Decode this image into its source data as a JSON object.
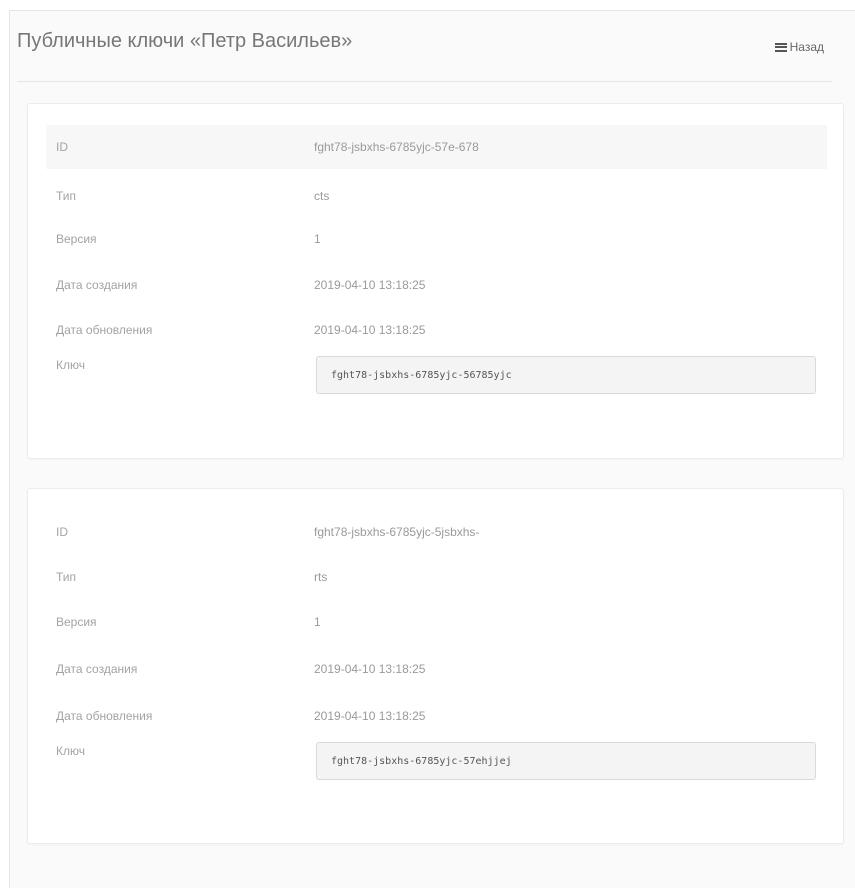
{
  "page": {
    "title": "Публичные ключи «Петр Васильев»",
    "back_label": "Назад"
  },
  "keys": [
    {
      "id_label": "ID",
      "id": "fght78-jsbxhs-6785yjc-57e-678",
      "type_label": "Тип",
      "type": "cts",
      "version_label": "Версия",
      "version": "1",
      "created_label": "Дата создания",
      "created": "2019-04-10 13:18:25",
      "updated_label": "Дата обновления",
      "updated": "2019-04-10 13:18:25",
      "key_label": "Ключ",
      "key": "fght78-jsbxhs-6785yjc-56785yjc"
    },
    {
      "id_label": "ID",
      "id": "fght78-jsbxhs-6785yjc-5jsbxhs-",
      "type_label": "Тип",
      "type": "rts",
      "version_label": "Версия",
      "version": "1",
      "created_label": "Дата создания",
      "created": "2019-04-10 13:18:25",
      "updated_label": "Дата обновления",
      "updated": "2019-04-10 13:18:25",
      "key_label": "Ключ",
      "key": "fght78-jsbxhs-6785yjc-57ehjjej"
    }
  ]
}
